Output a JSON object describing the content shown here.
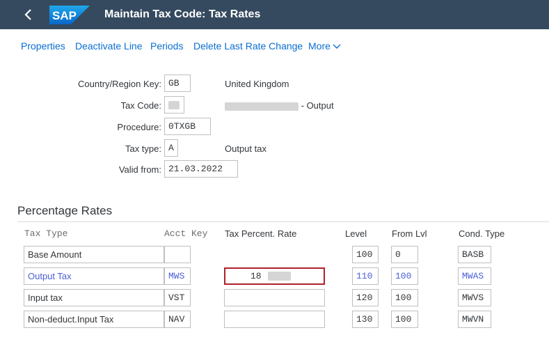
{
  "app": {
    "title": "Maintain Tax Code: Tax Rates",
    "logo_text": "SAP",
    "back_icon": "chevron-left-icon"
  },
  "toolbar": {
    "items": [
      "Properties",
      "Deactivate Line",
      "Periods",
      "Delete Last Rate Change"
    ],
    "more_label": "More"
  },
  "header_fields": {
    "country": {
      "label": "Country/Region Key:",
      "value": "GB",
      "description": "United Kingdom"
    },
    "tax_code": {
      "label": "Tax Code:",
      "value": "",
      "description": "- Output"
    },
    "procedure": {
      "label": "Procedure:",
      "value": "0TXGB"
    },
    "tax_type": {
      "label": "Tax type:",
      "value": "A",
      "description": "Output tax"
    },
    "valid_from": {
      "label": "Valid from:",
      "value": "21.03.2022"
    }
  },
  "rates": {
    "title": "Percentage Rates",
    "columns": [
      "Tax Type",
      "Acct Key",
      "Tax Percent. Rate",
      "Level",
      "From Lvl",
      "Cond. Type"
    ],
    "rows": [
      {
        "tax_type": "Base Amount",
        "acct_key": "",
        "rate": "",
        "level": "100",
        "from_lvl": "0",
        "cond_type": "BASB"
      },
      {
        "tax_type": "Output Tax",
        "acct_key": "MWS",
        "rate": "18",
        "level": "110",
        "from_lvl": "100",
        "cond_type": "MWAS"
      },
      {
        "tax_type": "Input tax",
        "acct_key": "VST",
        "rate": "",
        "level": "120",
        "from_lvl": "100",
        "cond_type": "MWVS"
      },
      {
        "tax_type": "Non-deduct.Input Tax",
        "acct_key": "NAV",
        "rate": "",
        "level": "130",
        "from_lvl": "100",
        "cond_type": "MWVN"
      }
    ]
  },
  "colors": {
    "shell": "#354a5f",
    "link": "#0a6ed1",
    "highlight_text": "#4b5fd7",
    "focus_border": "#b0202a"
  }
}
